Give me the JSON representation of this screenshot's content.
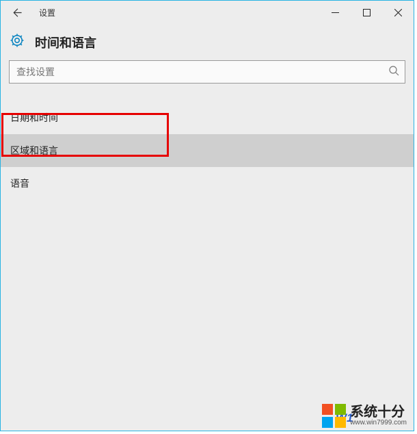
{
  "window": {
    "title": "设置"
  },
  "header": {
    "page_title": "时间和语言"
  },
  "search": {
    "placeholder": "查找设置"
  },
  "nav": {
    "items": [
      {
        "label": "日期和时间",
        "selected": false
      },
      {
        "label": "区域和语言",
        "selected": true
      },
      {
        "label": "语音",
        "selected": false
      }
    ]
  },
  "watermark": {
    "partial_text": "W1",
    "brand_main": "系统⼗分",
    "brand_url": "www.win7999.com"
  }
}
